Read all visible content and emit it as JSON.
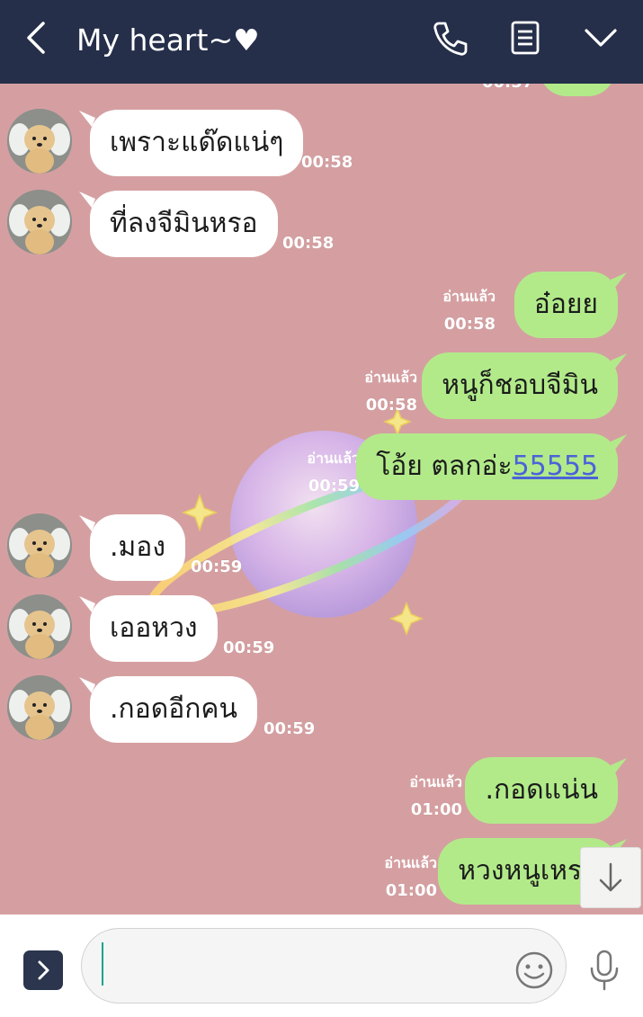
{
  "header": {
    "title": "My heart~♥",
    "bg": "#252f4a"
  },
  "chat": {
    "bg": "#d59fa1",
    "top_partial_time": "00:57",
    "messages": [
      {
        "side": "in",
        "text": "เพราะแด๊ดแน่ๆ",
        "time": "00:58"
      },
      {
        "side": "in",
        "text": "ที่ลงจีมินหรอ",
        "time": "00:58"
      },
      {
        "side": "out",
        "text": "อ๋อยย",
        "time": "00:58",
        "read": "อ่านแล้ว"
      },
      {
        "side": "out",
        "text": "หนูก็ชอบจีมิน",
        "time": "00:58",
        "read": "อ่านแล้ว"
      },
      {
        "side": "out",
        "text_before_link": "โอ้ย ตลกอ่ะ",
        "link": "55555",
        "time": "00:59",
        "read": "อ่านแล้ว"
      },
      {
        "side": "in",
        "text": ".มอง",
        "time": "00:59"
      },
      {
        "side": "in",
        "text": "เออหวง",
        "time": "00:59"
      },
      {
        "side": "in",
        "text": ".กอดอีกคน",
        "time": "00:59"
      },
      {
        "side": "out",
        "text": ".กอดแน่น",
        "time": "01:00",
        "read": "อ่านแล้ว"
      },
      {
        "side": "out",
        "text": "หวงหนูเหรอ",
        "time": "01:00",
        "read": "อ่านแล้ว"
      }
    ],
    "incoming_bubble_color": "#ffffff",
    "outgoing_bubble_color": "#b2ea8a",
    "link_color": "#4a63d8"
  },
  "icons": {
    "back": "chevron-left-icon",
    "call": "phone-icon",
    "notes": "notes-icon",
    "menu": "chevron-down-icon",
    "scroll": "arrow-down-icon",
    "expand": "chevron-right-icon",
    "emoji": "smiley-icon",
    "mic": "microphone-icon"
  }
}
